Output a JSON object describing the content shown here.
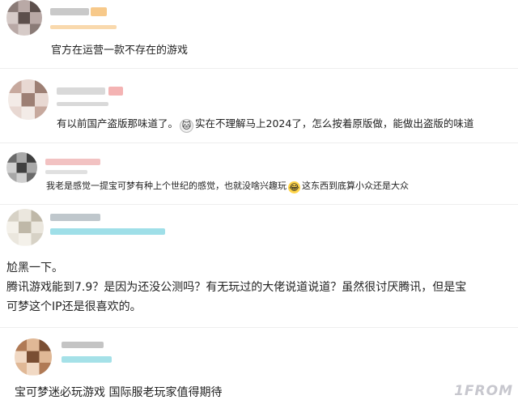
{
  "comments": [
    {
      "text": "官方在运营一款不存在的游戏",
      "avatar_colors": [
        "#8a7b77",
        "#b9a9a6",
        "#5c4f4c",
        "#d6cbc8"
      ],
      "name_color": "#c9c9c9",
      "badge_color": "#f7c98a"
    },
    {
      "text_before": "有以前国产盗版那味道了。",
      "emoji_icon": "cat-face-emoji-icon",
      "emoji_glyph": "🐱",
      "text_after": "实在不理解马上2024了，怎么按着原版做，能做出盗版的味道",
      "avatar_colors": [
        "#c7a99e",
        "#e8d8d2",
        "#9d7f74",
        "#f3ebe7"
      ],
      "name_color": "#d9d9d9",
      "badge_color": "#f4b3b3"
    },
    {
      "text_before": "我老是感觉一提宝可梦有种上个世纪的感觉，也就没啥兴趣玩",
      "emoji_icon": "laughing-emoji-icon",
      "emoji_glyph": "😂",
      "text_after": "这东西到底算小众还是大众",
      "avatar_colors": [
        "#6a6a6a",
        "#a8a8a8",
        "#3f3f3f",
        "#cfcfcf"
      ],
      "name_color": "#f2c2c2",
      "badge_color": "#e0e0e0"
    },
    {
      "lines": [
        "尬黑一下。",
        "腾讯游戏能到7.9？是因为还没公测吗？有无玩过的大佬说道说道？虽然很讨厌腾讯，但是宝",
        "可梦这个IP还是很喜欢的。"
      ],
      "avatar_colors": [
        "#d7d2c6",
        "#ebe7de",
        "#bfb8a8",
        "#f4f1ea"
      ],
      "name_color": "#bfc7cc",
      "badge_color": "#7fd4e0"
    },
    {
      "text": "宝可梦迷必玩游戏 国际服老玩家值得期待",
      "avatar_colors": [
        "#b07a55",
        "#e0b896",
        "#7a4e33",
        "#f1d9c4"
      ],
      "name_color": "#c4c4c4",
      "badge_color": "#8fd9e2"
    }
  ],
  "watermark": "1FROM"
}
